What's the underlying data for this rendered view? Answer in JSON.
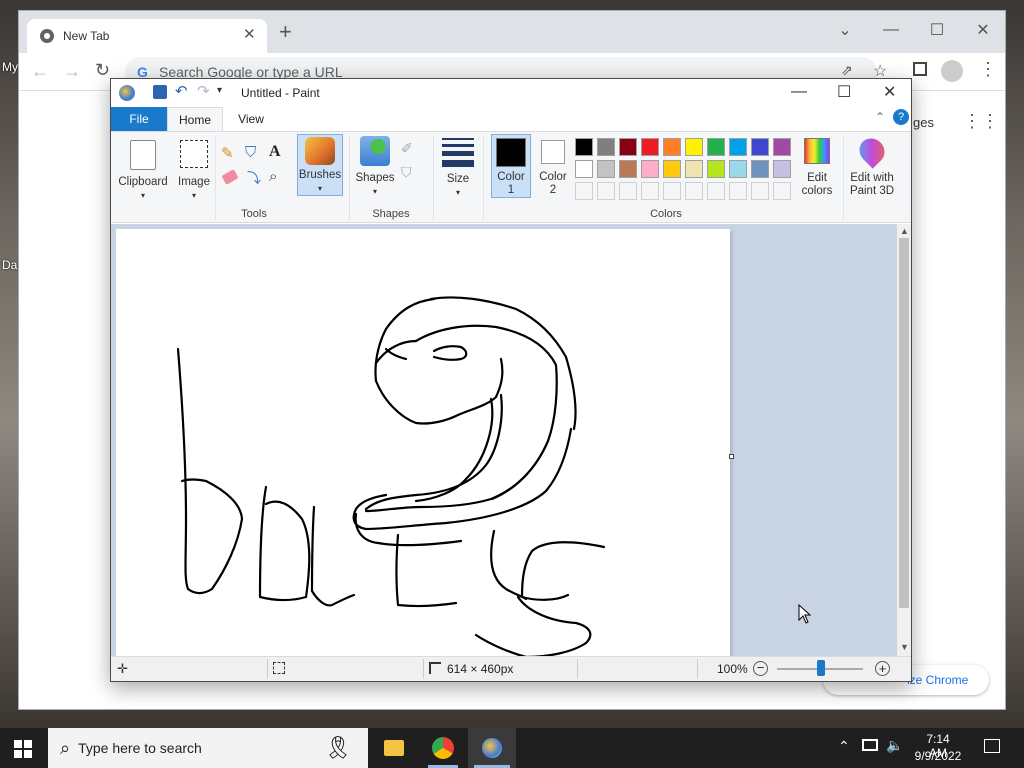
{
  "desktop": {
    "label_top": "My",
    "label_bottom": "Da"
  },
  "chrome": {
    "tab_title": "New Tab",
    "omnibox_placeholder": "Search Google or type a URL",
    "peek_images": "ges",
    "customize": "ize Chrome"
  },
  "paint": {
    "title": "Untitled - Paint",
    "menu": {
      "file": "File",
      "home": "Home",
      "view": "View"
    },
    "ribbon": {
      "clipboard": "Clipboard",
      "image": "Image",
      "tools": "Tools",
      "brushes": "Brushes",
      "shapes_btn": "Shapes",
      "shapes_group": "Shapes",
      "size": "Size",
      "color1_line1": "Color",
      "color1_line2": "1",
      "color2_line1": "Color",
      "color2_line2": "2",
      "colors_group": "Colors",
      "edit_colors_line1": "Edit",
      "edit_colors_line2": "colors",
      "edit3d_line1": "Edit with",
      "edit3d_line2": "Paint 3D"
    },
    "palette_row1": [
      "#000000",
      "#7f7f7f",
      "#880015",
      "#ed1c24",
      "#ff7f27",
      "#fff200",
      "#22b14c",
      "#00a2e8",
      "#3f48cc",
      "#a349a4"
    ],
    "palette_row2": [
      "#ffffff",
      "#c3c3c3",
      "#b97a57",
      "#ffaec9",
      "#ffc90e",
      "#efe4b0",
      "#b5e61d",
      "#99d9ea",
      "#7092be",
      "#c8bfe7"
    ],
    "color1": "#000000",
    "color2": "#ffffff",
    "status": {
      "size": "614 × 460px",
      "zoom": "100%"
    }
  },
  "taskbar": {
    "search_placeholder": "Type here to search",
    "time": "7:14 AM",
    "date": "9/9/2022"
  }
}
